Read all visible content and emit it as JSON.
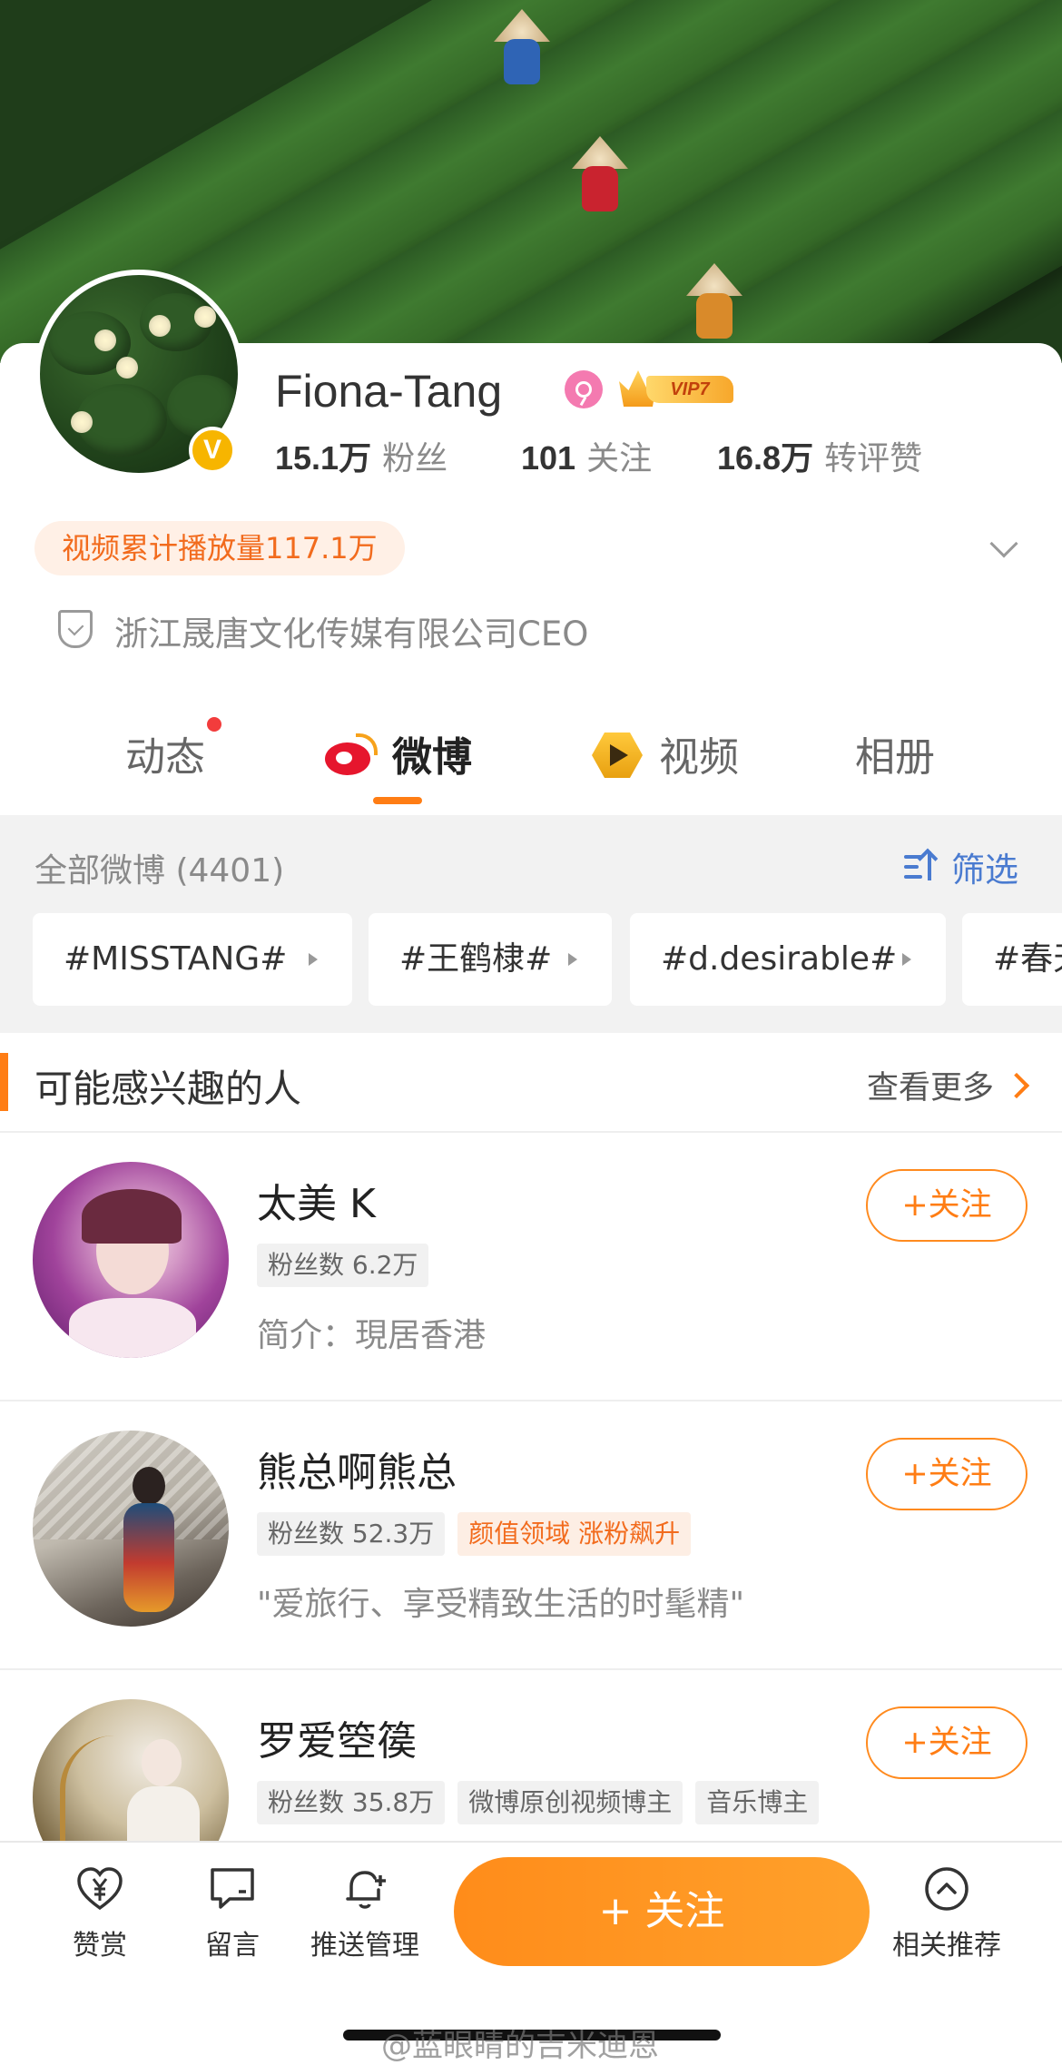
{
  "profile": {
    "name": "Fiona-Tang",
    "vip_label": "VIP7",
    "verified_mark": "V",
    "stats": [
      {
        "num": "15.1万",
        "label": "粉丝"
      },
      {
        "num": "101",
        "label": "关注"
      },
      {
        "num": "16.8万",
        "label": "转评赞"
      }
    ],
    "play_count": "视频累计播放量117.1万",
    "verification": "浙江晟唐文化传媒有限公司CEO"
  },
  "tabs": [
    {
      "label": "动态"
    },
    {
      "label": "微博"
    },
    {
      "label": "视频"
    },
    {
      "label": "相册"
    }
  ],
  "feed": {
    "all_label": "全部微博 (4401)",
    "filter_label": "筛选",
    "chips": [
      "#MISSTANG#",
      "#王鹤棣#",
      "#d.desirable#",
      "#春天"
    ]
  },
  "recommend": {
    "title": "可能感兴趣的人",
    "more": "查看更多",
    "follow_label": "+关注",
    "people": [
      {
        "name": "太美 K",
        "tags": [
          "粉丝数 6.2万"
        ],
        "hot_tag": "",
        "desc": "简介：現居香港"
      },
      {
        "name": "熊总啊熊总",
        "tags": [
          "粉丝数 52.3万"
        ],
        "hot_tag": "颜值领域 涨粉飙升",
        "desc": "\"爱旅行、享受精致生活的时髦精\""
      },
      {
        "name": "罗爱箜篌",
        "tags": [
          "粉丝数 35.8万",
          "微博原创视频博主",
          "音乐博主"
        ],
        "hot_tag": "",
        "desc": ""
      }
    ]
  },
  "bottom_bar": {
    "reward": "赞赏",
    "message": "留言",
    "push": "推送管理",
    "follow": "+ 关注",
    "related": "相关推荐"
  },
  "watermark": "@蓝眼睛的吉米迪恩",
  "colors": {
    "accent": "#ff7d14",
    "link_blue": "#4a7bd0",
    "weibo_red": "#e6162d"
  }
}
